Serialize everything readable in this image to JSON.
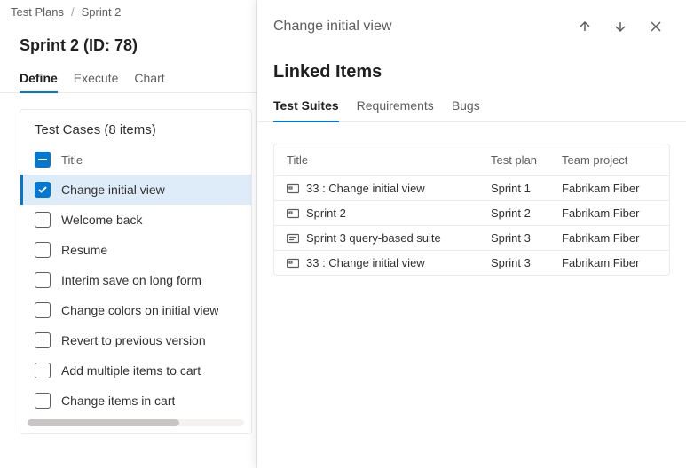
{
  "breadcrumb": {
    "root": "Test Plans",
    "current": "Sprint 2"
  },
  "page": {
    "title": "Sprint 2 (ID: 78)"
  },
  "tabs": {
    "define": "Define",
    "execute": "Execute",
    "chart": "Chart"
  },
  "testCases": {
    "header": "Test Cases (8 items)",
    "col_title": "Title",
    "items": [
      {
        "title": "Change initial view",
        "selected": true
      },
      {
        "title": "Welcome back",
        "selected": false
      },
      {
        "title": "Resume",
        "selected": false
      },
      {
        "title": "Interim save on long form",
        "selected": false
      },
      {
        "title": "Change colors on initial view",
        "selected": false
      },
      {
        "title": "Revert to previous version",
        "selected": false
      },
      {
        "title": "Add multiple items to cart",
        "selected": false
      },
      {
        "title": "Change items in cart",
        "selected": false
      }
    ]
  },
  "panel": {
    "title": "Change initial view",
    "section": "Linked Items",
    "tabs": {
      "suites": "Test Suites",
      "requirements": "Requirements",
      "bugs": "Bugs"
    },
    "columns": {
      "title": "Title",
      "plan": "Test plan",
      "project": "Team project"
    },
    "rows": [
      {
        "icon": "suite",
        "title": "33 : Change initial view",
        "plan": "Sprint 1",
        "project": "Fabrikam Fiber"
      },
      {
        "icon": "suite",
        "title": "Sprint 2",
        "plan": "Sprint 2",
        "project": "Fabrikam Fiber"
      },
      {
        "icon": "query-suite",
        "title": "Sprint 3 query-based suite",
        "plan": "Sprint 3",
        "project": "Fabrikam Fiber"
      },
      {
        "icon": "suite",
        "title": "33 : Change initial view",
        "plan": "Sprint 3",
        "project": "Fabrikam Fiber"
      }
    ]
  }
}
